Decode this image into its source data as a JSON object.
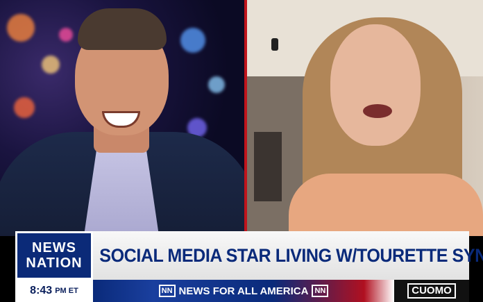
{
  "lower_third": {
    "logo_line1": "NEWS",
    "logo_line2": "NATION",
    "headline": "SOCIAL MEDIA STAR LIVING W/TOURETTE SYNDROME",
    "time": "8:43",
    "time_suffix": "PM ET",
    "ticker_badge_left": "NN",
    "ticker_text": "NEWS FOR ALL AMERICA",
    "ticker_badge_right": "NN",
    "show_name": "CUOMO"
  },
  "colors": {
    "brand_blue": "#0b2a78",
    "divider_red": "#c0141c",
    "headline_text": "#0a2a7a"
  }
}
